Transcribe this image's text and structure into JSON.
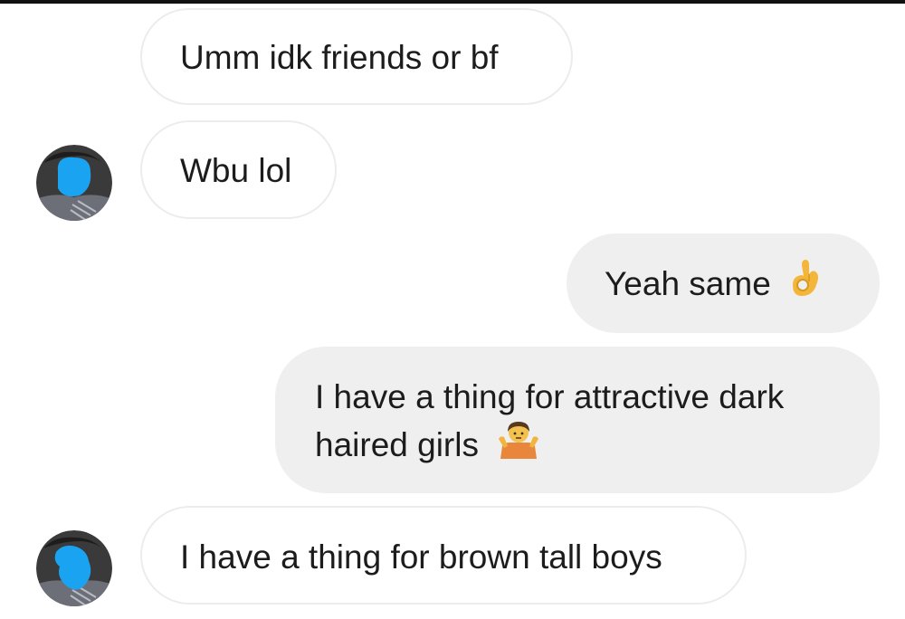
{
  "conversation": {
    "messages": [
      {
        "sender": "them",
        "text": "Umm idk friends or bf"
      },
      {
        "sender": "them",
        "text": "Wbu lol"
      },
      {
        "sender": "me",
        "text": "Yeah same",
        "emoji": "ok-hand-icon"
      },
      {
        "sender": "me",
        "line1": "I have a thing for attractive dark",
        "line2": "haired girls",
        "emoji": "shrug-icon"
      },
      {
        "sender": "them",
        "text": "I have a thing for brown tall boys"
      }
    ]
  },
  "colors": {
    "outgoing_bubble": "#efefef",
    "incoming_border": "#ececec",
    "text": "#1c1c1c",
    "avatar_redaction": "#1aa3f0"
  }
}
